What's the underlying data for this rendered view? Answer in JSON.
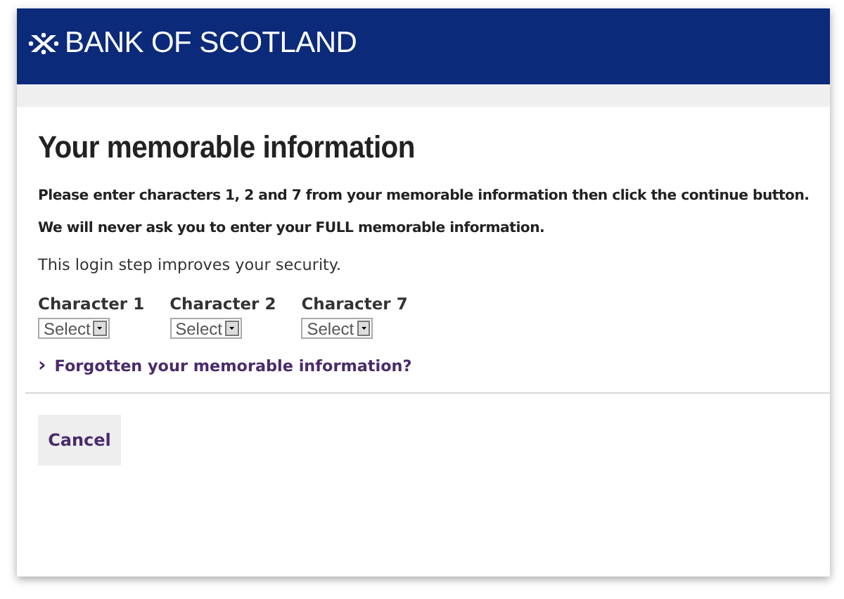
{
  "header": {
    "logo_text": "BANK OF SCOTLAND"
  },
  "heading": "Your memorable information",
  "instructions": [
    "Please enter characters 1, 2 and 7 from your memorable information then click the continue button.",
    "We will never ask you to enter your FULL memorable information."
  ],
  "note": "This login step improves your security.",
  "characters": [
    {
      "label": "Character 1",
      "placeholder": "Select"
    },
    {
      "label": "Character 2",
      "placeholder": "Select"
    },
    {
      "label": "Character 7",
      "placeholder": "Select"
    }
  ],
  "link": {
    "icon": "›",
    "text": "Forgotten your memorable information?"
  },
  "buttons": [
    "Cancel"
  ]
}
